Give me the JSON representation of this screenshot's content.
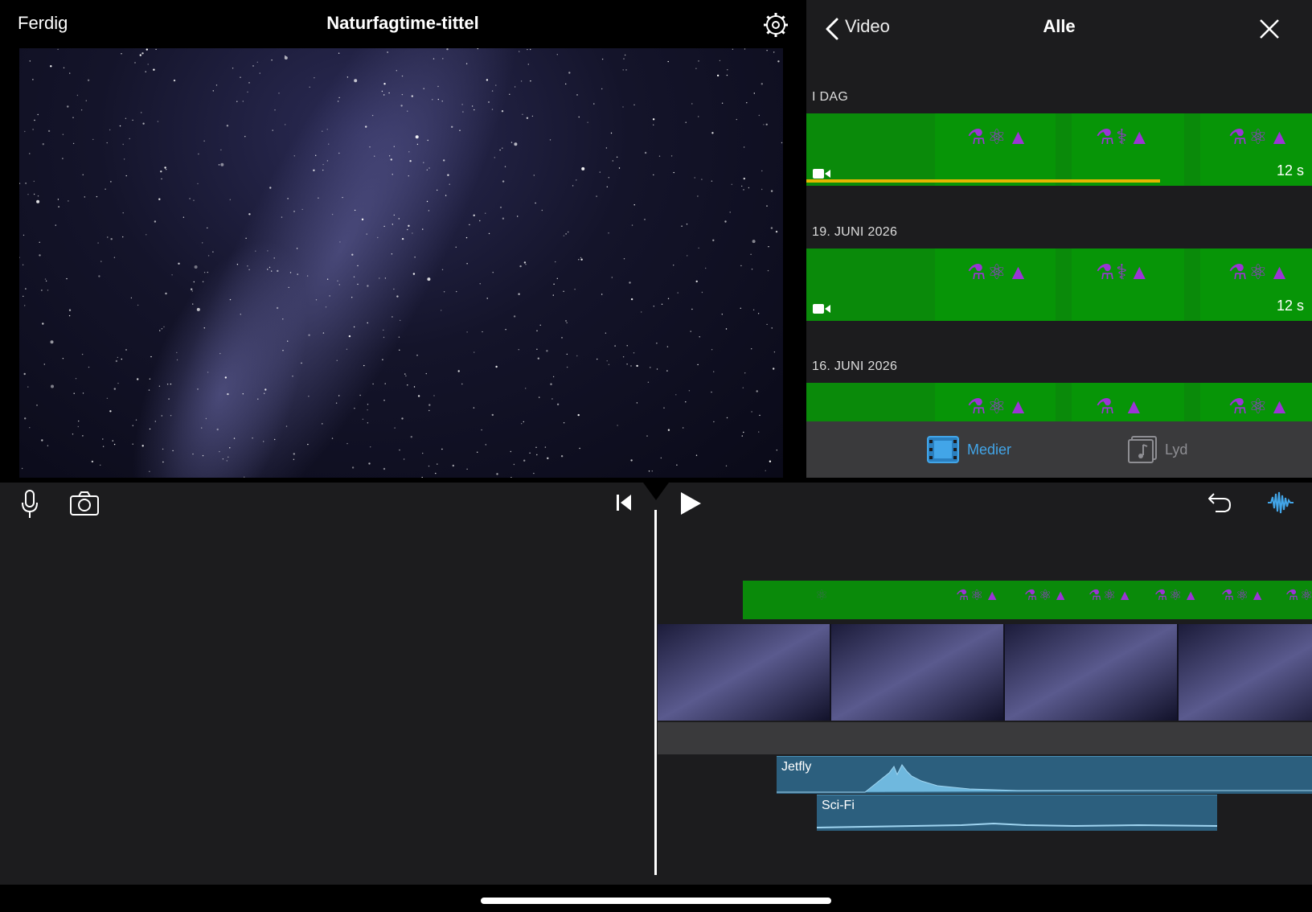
{
  "header": {
    "done_label": "Ferdig",
    "project_title": "Naturfagtime-tittel"
  },
  "browser": {
    "back_label": "Video",
    "title": "Alle",
    "sections": [
      {
        "label": "I DAG",
        "duration": "12 s",
        "progress": 0.7
      },
      {
        "label": "19. JUNI 2026",
        "duration": "12 s"
      },
      {
        "label": "16. JUNI 2026"
      }
    ],
    "tabs": {
      "media": "Medier",
      "audio": "Lyd"
    }
  },
  "timeline": {
    "audio_tracks": [
      {
        "name": "Jetfly"
      },
      {
        "name": "Sci-Fi"
      }
    ]
  },
  "colors": {
    "accent_blue": "#42a5e8",
    "clip_green": "#0a8a0a",
    "audio_track": "#2c5f7e",
    "progress_yellow": "#e5b500",
    "icon_purple": "#9b34d6"
  }
}
